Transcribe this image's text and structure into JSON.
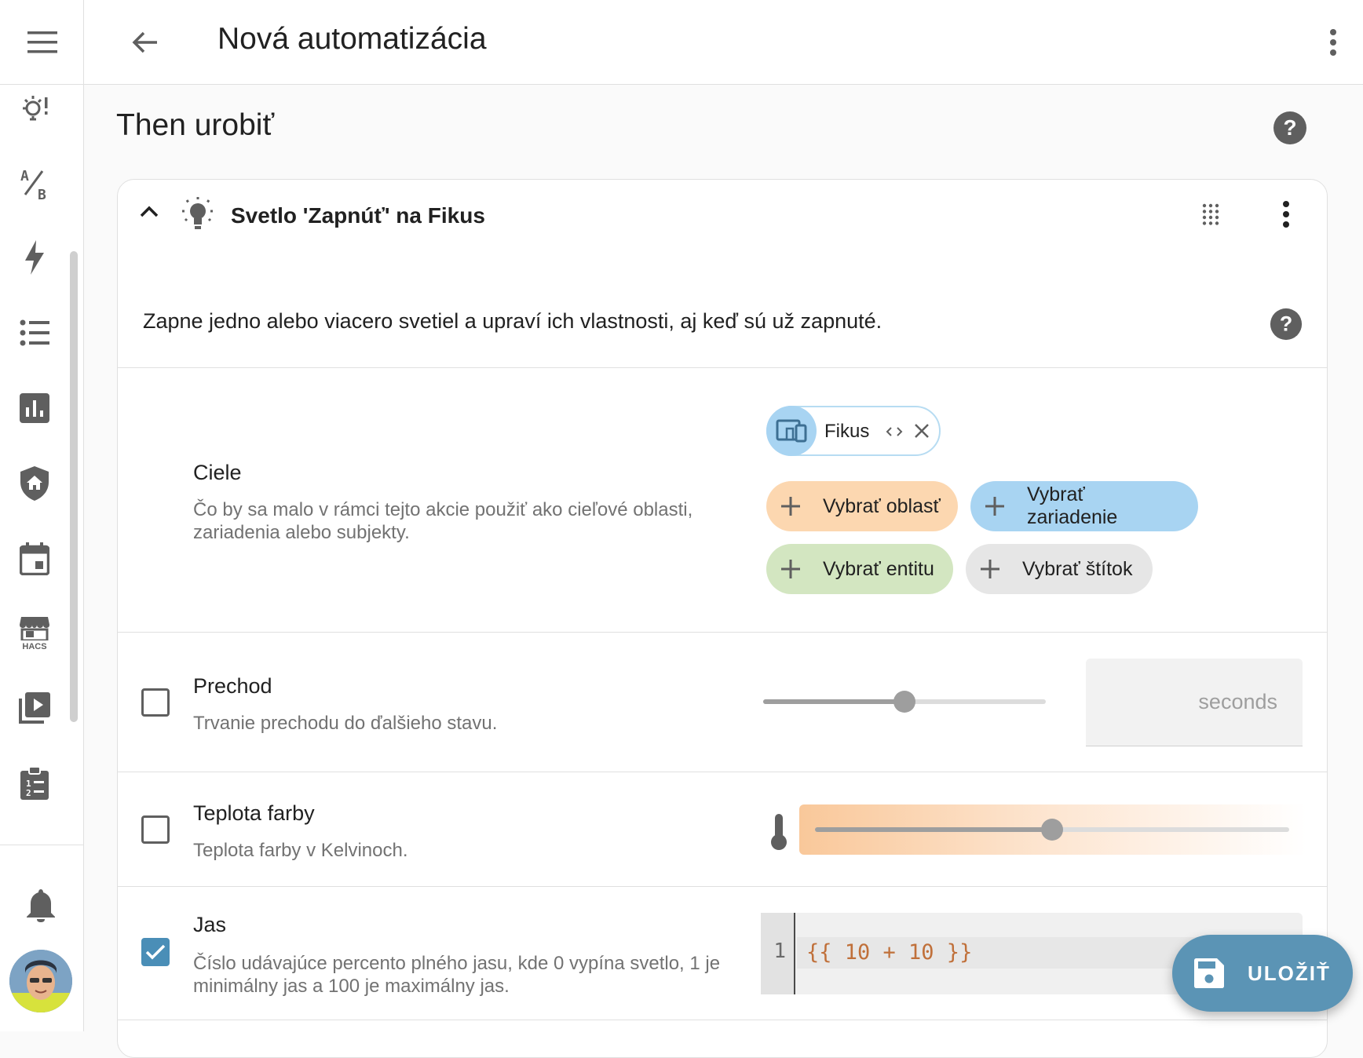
{
  "header": {
    "title": "Nová automatizácia"
  },
  "sidebar": {
    "items": [
      {
        "icon": "lightbulb-alert-icon"
      },
      {
        "icon": "ab-testing-icon"
      },
      {
        "icon": "lightning-icon"
      },
      {
        "icon": "format-list-bulleted-icon"
      },
      {
        "icon": "chart-box-icon"
      },
      {
        "icon": "shield-home-icon"
      },
      {
        "icon": "calendar-icon"
      },
      {
        "icon": "hacs-store-icon",
        "label": "HACS"
      },
      {
        "icon": "play-box-multiple-icon"
      },
      {
        "icon": "clipboard-list-icon"
      }
    ],
    "notifications_icon": "bell-icon",
    "avatar_icon": "user-avatar"
  },
  "section": {
    "title": "Then urobiť"
  },
  "action": {
    "title": "Svetlo 'Zapnúť' na Fikus",
    "description": "Zapne jedno alebo viacero svetiel a upraví ich vlastnosti, aj keď sú už zapnuté."
  },
  "targets": {
    "label": "Ciele",
    "sub": "Čo by sa malo v rámci tejto akcie použiť ako cieľové oblasti, zariadenia alebo subjekty.",
    "selected_chip": "Fikus",
    "buttons": {
      "area": "Vybrať oblasť",
      "device": "Vybrať zariadenie",
      "entity": "Vybrať entitu",
      "label": "Vybrať štítok"
    },
    "colors": {
      "area": "#fcd7b0",
      "device": "#a8d4f2",
      "entity": "#d3e6c1",
      "label": "#e6e6e6"
    }
  },
  "transition": {
    "label": "Prechod",
    "sub": "Trvanie prechodu do ďalšieho stavu.",
    "enabled": false,
    "slider_fraction": 0.5,
    "unit": "seconds"
  },
  "color_temp": {
    "label": "Teplota farby",
    "sub": "Teplota farby v Kelvinoch.",
    "enabled": false,
    "slider_fraction": 0.5
  },
  "brightness": {
    "label": "Jas",
    "sub_line1": "Číslo udávajúce percento plného jasu, kde 0 vypína svetlo, 1 je",
    "sub_line2": "minimálny jas a 100 je maximálny jas.",
    "enabled": true,
    "code_line_number": "1",
    "code": "{{ 10 + 10 }}"
  },
  "fab": {
    "label": "ULOŽIŤ"
  },
  "colors": {
    "accent": "#4a8eb7",
    "fab": "#5b94b5",
    "icon_gray": "#5f5f5f"
  }
}
